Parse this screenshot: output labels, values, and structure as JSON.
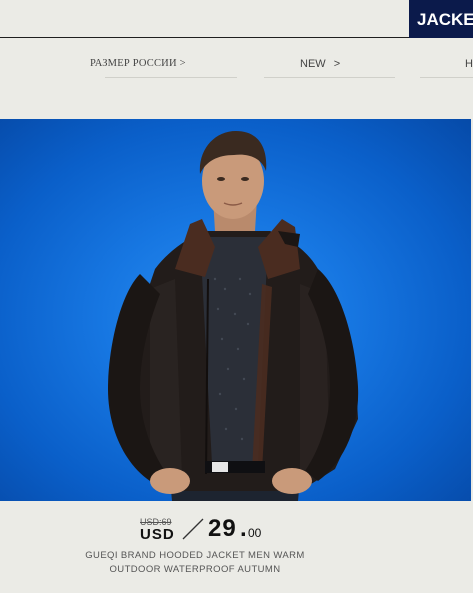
{
  "header": {
    "badge_label": "JACKET"
  },
  "nav": {
    "items": [
      {
        "label": "РАЗМЕР РОССИИ",
        "arrow": ">"
      },
      {
        "label": "NEW",
        "arrow": ">"
      },
      {
        "label": "H"
      }
    ]
  },
  "product": {
    "image_alt": "Man in dark hooded jacket on blue background",
    "old_price": "USD:69",
    "currency": "USD",
    "price_integer": "29",
    "price_dot": ".",
    "price_cents": "00",
    "title_line_1": "GUEQI BRAND HOODED JACKET MEN WARM",
    "title_line_2": "OUTDOOR WATERPROOF AUTUMN"
  },
  "colors": {
    "page_background": "#ebebe6",
    "badge_background": "#0b1a4b",
    "photo_background": "#1777e2"
  }
}
